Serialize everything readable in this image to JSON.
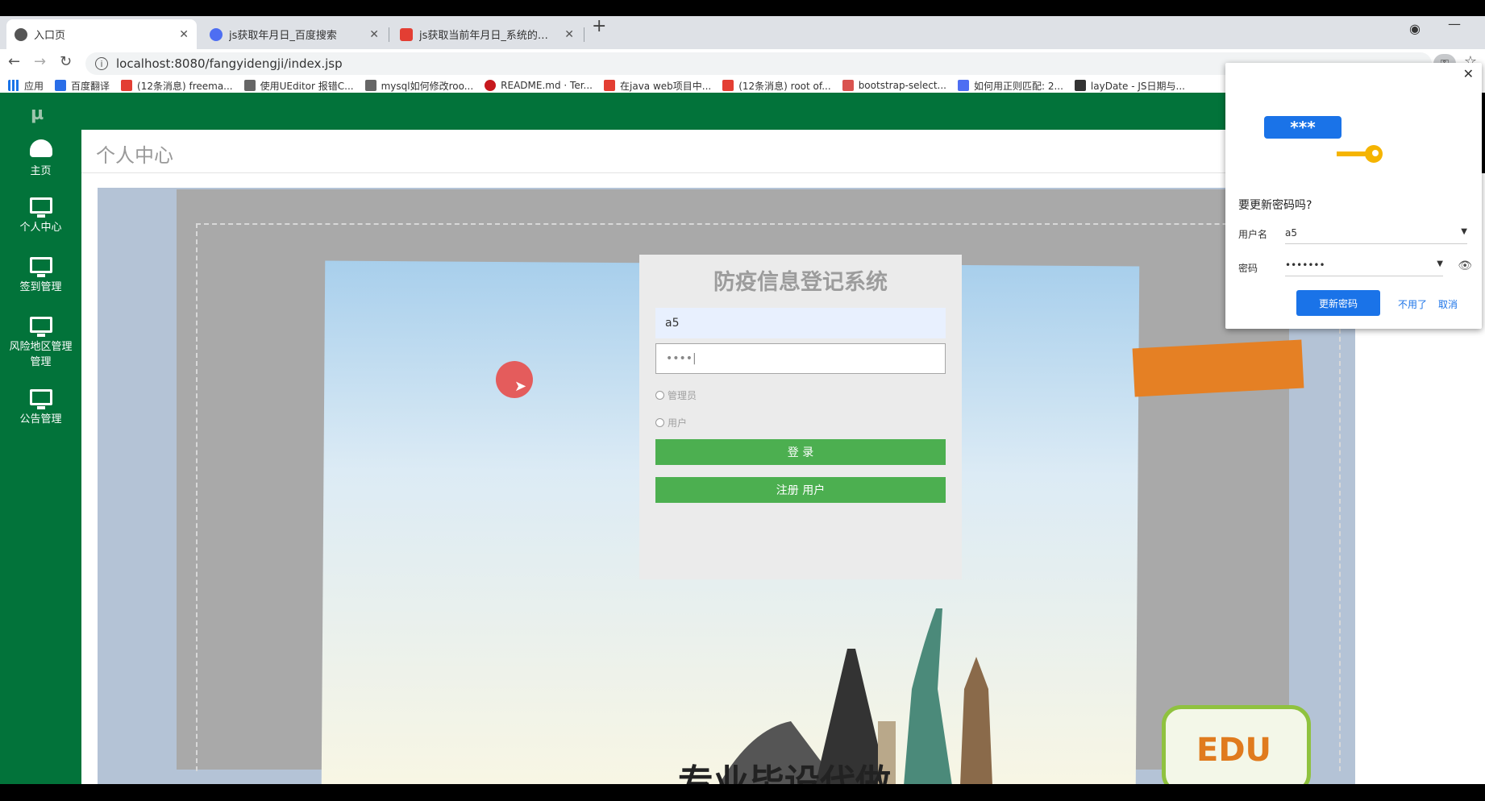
{
  "browser": {
    "tabs": [
      {
        "title": "入口页",
        "active": true
      },
      {
        "title": "js获取年月日_百度搜索",
        "active": false
      },
      {
        "title": "js获取当前年月日_系统的个人...",
        "active": false
      }
    ],
    "address": "localhost:8080/fangyidengji/index.jsp",
    "bookmarks": [
      "应用",
      "百度翻译",
      "(12条消息) freema...",
      "使用UEditor 报错C...",
      "mysql如何修改roo...",
      "README.md · Ter...",
      "在java web项目中...",
      "(12条消息) root of...",
      "bootstrap-select...",
      "如何用正则匹配: 2...",
      "layDate - JS日期与..."
    ]
  },
  "sidebar": {
    "logo": "µ",
    "items": [
      {
        "label": "主页",
        "icon": "dashboard-icon"
      },
      {
        "label": "个人中心",
        "icon": "monitor-icon"
      },
      {
        "label": "签到管理",
        "icon": "monitor-icon"
      },
      {
        "label": "风险地区管理",
        "sublabel": "管理",
        "icon": "monitor-icon"
      },
      {
        "label": "公告管理",
        "icon": "monitor-icon"
      }
    ]
  },
  "page": {
    "title": "个人中心"
  },
  "login": {
    "title": "防疫信息登记系统",
    "username": "a5",
    "password_mask": "••••|",
    "role_admin": "管理员",
    "role_user": "用户",
    "login_label": "登 录",
    "register_label": "注册 用户"
  },
  "password_popup": {
    "art_text": "***",
    "title": "要更新密码吗?",
    "username_label": "用户名",
    "username_value": "a5",
    "password_label": "密码",
    "password_value": "•••••••",
    "update_label": "更新密码",
    "no_label": "不用了",
    "cancel_label": "取消"
  },
  "decor": {
    "edu_text": "EDU",
    "watermark": "专业毕设代做"
  },
  "colors": {
    "sidebar_green": "#02733a",
    "button_green": "#4caf50",
    "chrome_blue": "#1a73e8"
  }
}
